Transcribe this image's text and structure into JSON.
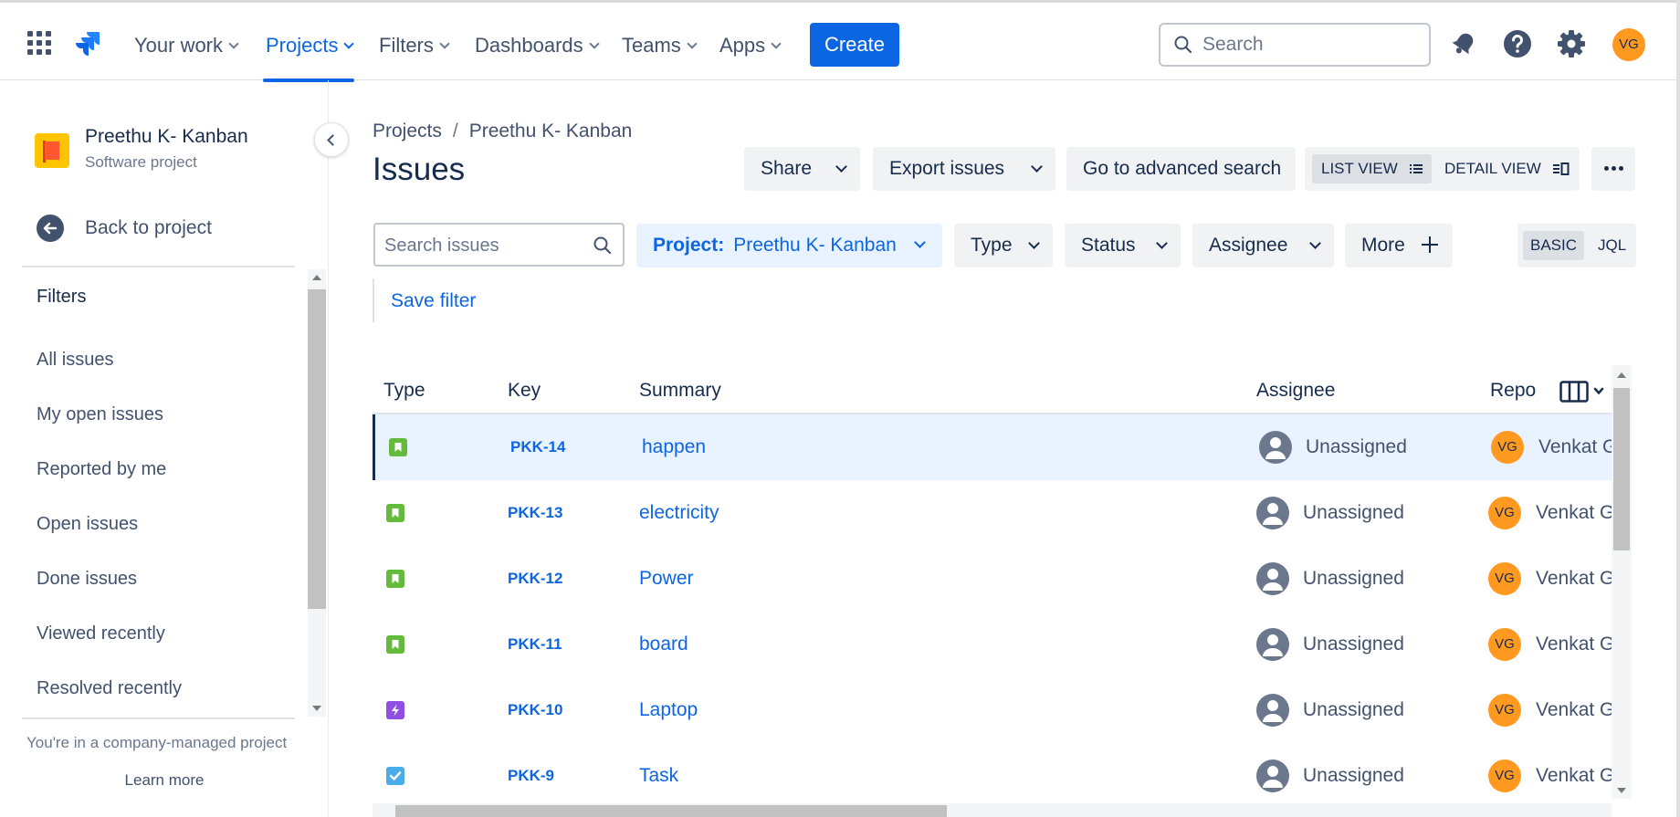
{
  "nav": {
    "items": [
      {
        "label": "Your work"
      },
      {
        "label": "Projects"
      },
      {
        "label": "Filters"
      },
      {
        "label": "Dashboards"
      },
      {
        "label": "Teams"
      },
      {
        "label": "Apps"
      }
    ],
    "create_label": "Create",
    "search_placeholder": "Search",
    "user_initials": "VG"
  },
  "sidebar": {
    "project_name": "Preethu K- Kanban",
    "project_type": "Software project",
    "back_label": "Back to project",
    "filters_title": "Filters",
    "filters": [
      {
        "label": "All issues"
      },
      {
        "label": "My open issues"
      },
      {
        "label": "Reported by me"
      },
      {
        "label": "Open issues"
      },
      {
        "label": "Done issues"
      },
      {
        "label": "Viewed recently"
      },
      {
        "label": "Resolved recently"
      }
    ],
    "company_note": "You're in a company-managed project",
    "learn_more": "Learn more"
  },
  "main": {
    "breadcrumb": [
      "Projects",
      "Preethu K- Kanban"
    ],
    "breadcrumb_sep": "/",
    "title": "Issues",
    "actions": {
      "share": "Share",
      "export": "Export issues",
      "advanced_search": "Go to advanced search",
      "list_view": "LIST VIEW",
      "detail_view": "DETAIL VIEW"
    },
    "filters": {
      "search_placeholder": "Search issues",
      "project_label": "Project:",
      "project_value": "Preethu K- Kanban",
      "type": "Type",
      "status": "Status",
      "assignee": "Assignee",
      "more": "More",
      "basic": "BASIC",
      "jql": "JQL",
      "save_filter": "Save filter"
    }
  },
  "table": {
    "columns": [
      "Type",
      "Key",
      "Summary",
      "Assignee",
      "Repo"
    ],
    "rows": [
      {
        "type_icon": "story-icon",
        "key": "PKK-14",
        "summary": "happen",
        "assignee": "Unassigned",
        "reporter_initials": "VG",
        "reporter": "Venkat G"
      },
      {
        "type_icon": "story-icon",
        "key": "PKK-13",
        "summary": "electricity",
        "assignee": "Unassigned",
        "reporter_initials": "VG",
        "reporter": "Venkat G"
      },
      {
        "type_icon": "story-icon",
        "key": "PKK-12",
        "summary": "Power",
        "assignee": "Unassigned",
        "reporter_initials": "VG",
        "reporter": "Venkat G"
      },
      {
        "type_icon": "story-icon",
        "key": "PKK-11",
        "summary": "board",
        "assignee": "Unassigned",
        "reporter_initials": "VG",
        "reporter": "Venkat G"
      },
      {
        "type_icon": "epic-icon",
        "key": "PKK-10",
        "summary": "Laptop",
        "assignee": "Unassigned",
        "reporter_initials": "VG",
        "reporter": "Venkat G"
      },
      {
        "type_icon": "task-icon",
        "key": "PKK-9",
        "summary": "Task",
        "assignee": "Unassigned",
        "reporter_initials": "VG",
        "reporter": "Venkat G"
      }
    ]
  },
  "colors": {
    "accent": "#0c66e4",
    "story": "#63ba3c",
    "epic": "#904ee2",
    "task": "#4bade8",
    "avatar": "#ff991f"
  }
}
